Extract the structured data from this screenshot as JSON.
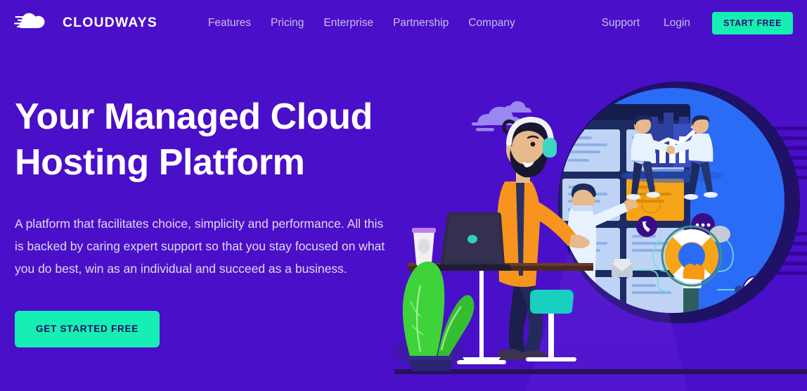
{
  "brand": {
    "name": "CLOUDWAYS",
    "logo_icon": "cloud-speed-icon",
    "background_color": "#4A0FC8",
    "accent_color": "#16EFB4",
    "accent_text_color": "#1B0E63"
  },
  "nav": {
    "links": [
      {
        "label": "Features"
      },
      {
        "label": "Pricing"
      },
      {
        "label": "Enterprise"
      },
      {
        "label": "Partnership"
      },
      {
        "label": "Company"
      }
    ],
    "right_links": [
      {
        "label": "Support"
      },
      {
        "label": "Login"
      }
    ],
    "cta_label": "START FREE"
  },
  "hero": {
    "headline_line1": "Your Managed Cloud",
    "headline_line2": "Hosting Platform",
    "subcopy": "A platform that facilitates choice, simplicity and performance. All this is backed by caring expert support so that you stay focused on what you do best, win as an individual and succeed as a business.",
    "cta_label": "GET STARTED FREE"
  },
  "illustration": {
    "name": "managed-cloud-hosting-illustration",
    "elements": [
      "cloud-small-icon",
      "cloud-large-icon",
      "browser-window",
      "card-grid",
      "highlighted-orange-card",
      "person-touching-card",
      "two-people-carrying-growth-chart",
      "growth-chart-icon",
      "lifebuoy-icon",
      "phone-icon",
      "chat-bubble-icon",
      "envelope-icon",
      "clock-icon",
      "bearded-man-with-headphones",
      "laptop",
      "coffee-cup",
      "desk",
      "stool",
      "potted-plant",
      "floor-line"
    ]
  }
}
